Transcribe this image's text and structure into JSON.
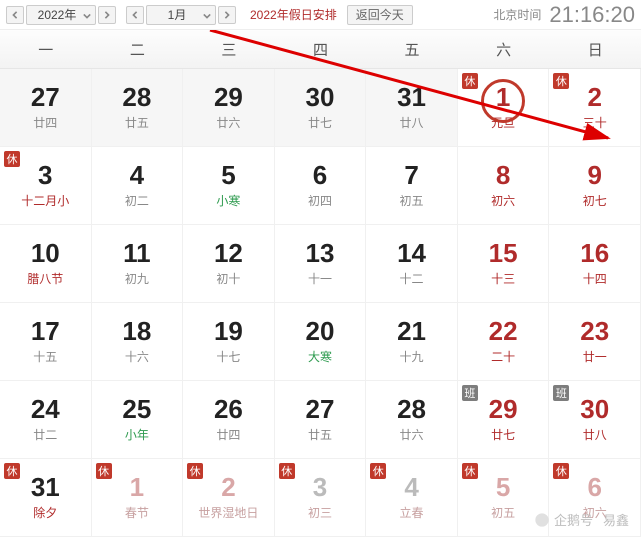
{
  "toolbar": {
    "year": "2022年",
    "month": "1月",
    "holiday_link": "2022年假日安排",
    "today_btn": "返回今天",
    "tz_label": "北京时间",
    "clock": "21:16:20"
  },
  "weekdays": [
    "一",
    "二",
    "三",
    "四",
    "五",
    "六",
    "日"
  ],
  "cells": [
    {
      "n": "27",
      "s": "廿四",
      "cls": "past"
    },
    {
      "n": "28",
      "s": "廿五",
      "cls": "past"
    },
    {
      "n": "29",
      "s": "廿六",
      "cls": "past"
    },
    {
      "n": "30",
      "s": "廿七",
      "cls": "past"
    },
    {
      "n": "31",
      "s": "廿八",
      "cls": "past"
    },
    {
      "n": "1",
      "s": "元旦",
      "cls": "weekend",
      "badge": "rest",
      "today": true,
      "subcls": "fest"
    },
    {
      "n": "2",
      "s": "三十",
      "cls": "weekend",
      "badge": "rest"
    },
    {
      "n": "3",
      "s": "十二月小",
      "cls": "",
      "badge": "rest",
      "subcls": "fest"
    },
    {
      "n": "4",
      "s": "初二",
      "cls": ""
    },
    {
      "n": "5",
      "s": "小寒",
      "cls": "",
      "subcls": "term"
    },
    {
      "n": "6",
      "s": "初四",
      "cls": ""
    },
    {
      "n": "7",
      "s": "初五",
      "cls": ""
    },
    {
      "n": "8",
      "s": "初六",
      "cls": "weekend"
    },
    {
      "n": "9",
      "s": "初七",
      "cls": "weekend"
    },
    {
      "n": "10",
      "s": "腊八节",
      "cls": "",
      "subcls": "fest"
    },
    {
      "n": "11",
      "s": "初九",
      "cls": ""
    },
    {
      "n": "12",
      "s": "初十",
      "cls": ""
    },
    {
      "n": "13",
      "s": "十一",
      "cls": ""
    },
    {
      "n": "14",
      "s": "十二",
      "cls": ""
    },
    {
      "n": "15",
      "s": "十三",
      "cls": "weekend"
    },
    {
      "n": "16",
      "s": "十四",
      "cls": "weekend"
    },
    {
      "n": "17",
      "s": "十五",
      "cls": ""
    },
    {
      "n": "18",
      "s": "十六",
      "cls": ""
    },
    {
      "n": "19",
      "s": "十七",
      "cls": ""
    },
    {
      "n": "20",
      "s": "大寒",
      "cls": "",
      "subcls": "term"
    },
    {
      "n": "21",
      "s": "十九",
      "cls": ""
    },
    {
      "n": "22",
      "s": "二十",
      "cls": "weekend"
    },
    {
      "n": "23",
      "s": "廿一",
      "cls": "weekend"
    },
    {
      "n": "24",
      "s": "廿二",
      "cls": ""
    },
    {
      "n": "25",
      "s": "小年",
      "cls": "",
      "subcls": "term"
    },
    {
      "n": "26",
      "s": "廿四",
      "cls": ""
    },
    {
      "n": "27",
      "s": "廿五",
      "cls": ""
    },
    {
      "n": "28",
      "s": "廿六",
      "cls": ""
    },
    {
      "n": "29",
      "s": "廿七",
      "cls": "weekend",
      "badge": "work"
    },
    {
      "n": "30",
      "s": "廿八",
      "cls": "weekend",
      "badge": "work"
    },
    {
      "n": "31",
      "s": "除夕",
      "cls": "",
      "badge": "rest",
      "subcls": "fest"
    },
    {
      "n": "1",
      "s": "春节",
      "cls": "dim weekend",
      "badge": "rest",
      "subcls": "fest"
    },
    {
      "n": "2",
      "s": "世界湿地日",
      "cls": "dim weekend",
      "badge": "rest",
      "subcls": "fest"
    },
    {
      "n": "3",
      "s": "初三",
      "cls": "dim",
      "badge": "rest"
    },
    {
      "n": "4",
      "s": "立春",
      "cls": "dim",
      "badge": "rest",
      "subcls": "fest"
    },
    {
      "n": "5",
      "s": "初五",
      "cls": "dim weekend",
      "badge": "rest"
    },
    {
      "n": "6",
      "s": "初六",
      "cls": "dim weekend",
      "badge": "rest"
    }
  ],
  "badge_text": {
    "rest": "休",
    "work": "班"
  },
  "watermark": {
    "brand": "企鹅号",
    "author": "易鑫"
  }
}
